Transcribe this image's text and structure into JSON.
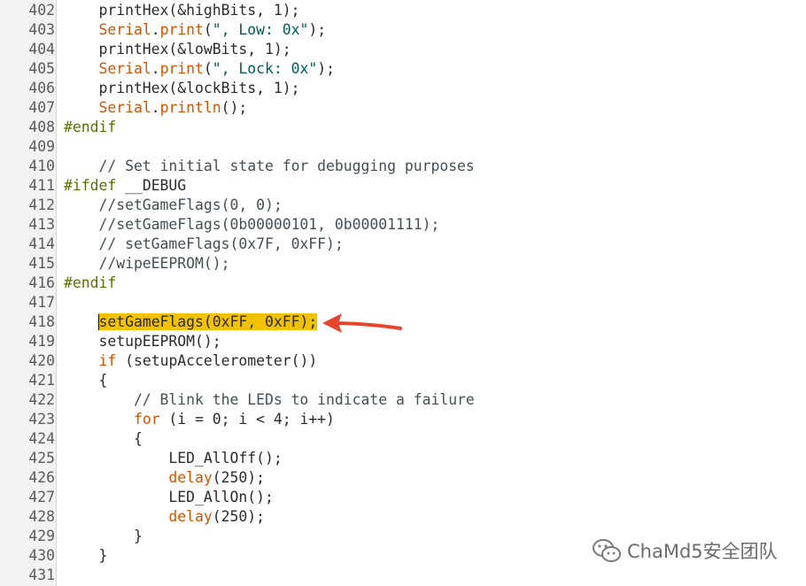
{
  "lines": [
    {
      "num": "402",
      "segs": [
        [
          "    printHex(&highBits, 1);",
          "n"
        ]
      ]
    },
    {
      "num": "403",
      "segs": [
        [
          "    ",
          "n"
        ],
        [
          "Serial",
          "kw"
        ],
        [
          ".",
          "n"
        ],
        [
          "print",
          "kw"
        ],
        [
          "(",
          "n"
        ],
        [
          "\", Low: 0x\"",
          "str"
        ],
        [
          ");",
          "n"
        ]
      ]
    },
    {
      "num": "404",
      "segs": [
        [
          "    printHex(&lowBits, 1);",
          "n"
        ]
      ]
    },
    {
      "num": "405",
      "segs": [
        [
          "    ",
          "n"
        ],
        [
          "Serial",
          "kw"
        ],
        [
          ".",
          "n"
        ],
        [
          "print",
          "kw"
        ],
        [
          "(",
          "n"
        ],
        [
          "\", Lock: 0x\"",
          "str"
        ],
        [
          ");",
          "n"
        ]
      ]
    },
    {
      "num": "406",
      "segs": [
        [
          "    printHex(&lockBits, 1);",
          "n"
        ]
      ]
    },
    {
      "num": "407",
      "segs": [
        [
          "    ",
          "n"
        ],
        [
          "Serial",
          "kw"
        ],
        [
          ".",
          "n"
        ],
        [
          "println",
          "kw"
        ],
        [
          "();",
          "n"
        ]
      ]
    },
    {
      "num": "408",
      "segs": [
        [
          "#endif",
          "pp"
        ]
      ]
    },
    {
      "num": "409",
      "segs": []
    },
    {
      "num": "410",
      "segs": [
        [
          "    // Set initial state for debugging purposes",
          "cm"
        ]
      ]
    },
    {
      "num": "411",
      "segs": [
        [
          "#ifdef",
          "pp"
        ],
        [
          " __DEBUG",
          "n"
        ]
      ]
    },
    {
      "num": "412",
      "segs": [
        [
          "    //setGameFlags(0, 0);",
          "cm"
        ]
      ]
    },
    {
      "num": "413",
      "segs": [
        [
          "    //setGameFlags(0b00000101, 0b00001111);",
          "cm"
        ]
      ]
    },
    {
      "num": "414",
      "segs": [
        [
          "    // setGameFlags(0x7F, 0xFF);",
          "cm"
        ]
      ]
    },
    {
      "num": "415",
      "segs": [
        [
          "    //wipeEEPROM();",
          "cm"
        ]
      ]
    },
    {
      "num": "416",
      "segs": [
        [
          "#endif",
          "pp"
        ]
      ]
    },
    {
      "num": "417",
      "segs": []
    },
    {
      "num": "418",
      "segs": [
        [
          "    ",
          "n"
        ],
        [
          "setGameFlags(0xFF, 0xFF);",
          "hl"
        ]
      ]
    },
    {
      "num": "419",
      "segs": [
        [
          "    setupEEPROM();",
          "n"
        ]
      ]
    },
    {
      "num": "420",
      "segs": [
        [
          "    ",
          "n"
        ],
        [
          "if",
          "kw"
        ],
        [
          " (setupAccelerometer())",
          "n"
        ]
      ]
    },
    {
      "num": "421",
      "segs": [
        [
          "    {",
          "n"
        ]
      ]
    },
    {
      "num": "422",
      "segs": [
        [
          "        // Blink the LEDs to indicate a failure",
          "cm"
        ]
      ]
    },
    {
      "num": "423",
      "segs": [
        [
          "        ",
          "n"
        ],
        [
          "for",
          "kw"
        ],
        [
          " (i = 0; i < 4; i++)",
          "n"
        ]
      ]
    },
    {
      "num": "424",
      "segs": [
        [
          "        {",
          "n"
        ]
      ]
    },
    {
      "num": "425",
      "segs": [
        [
          "            LED_AllOff();",
          "n"
        ]
      ]
    },
    {
      "num": "426",
      "segs": [
        [
          "            ",
          "n"
        ],
        [
          "delay",
          "kw"
        ],
        [
          "(250);",
          "n"
        ]
      ]
    },
    {
      "num": "427",
      "segs": [
        [
          "            LED_AllOn();",
          "n"
        ]
      ]
    },
    {
      "num": "428",
      "segs": [
        [
          "            ",
          "n"
        ],
        [
          "delay",
          "kw"
        ],
        [
          "(250);",
          "n"
        ]
      ]
    },
    {
      "num": "429",
      "segs": [
        [
          "        }",
          "n"
        ]
      ]
    },
    {
      "num": "430",
      "segs": [
        [
          "    }",
          "n"
        ]
      ]
    },
    {
      "num": "431",
      "segs": []
    }
  ],
  "annotation": {
    "arrow_color": "#e8452c",
    "points_to_line": "418"
  },
  "watermark": {
    "text": "ChaMd5安全团队",
    "icon": "wechat-icon"
  },
  "colors": {
    "keyword": "#d35400",
    "string": "#005c5f",
    "preprocessor": "#5e6d03",
    "comment": "#434f54",
    "highlight": "#f2c200"
  }
}
